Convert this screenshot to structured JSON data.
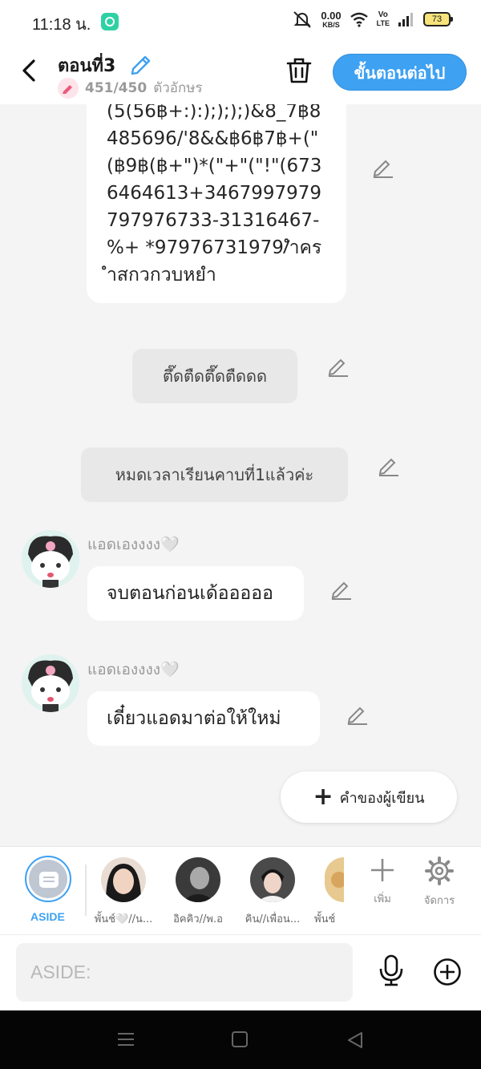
{
  "status": {
    "time": "11:18 น.",
    "net_speed": "0.00",
    "net_unit": "KB/S",
    "volte_top": "Vo",
    "volte_bottom": "LTE",
    "battery": "73"
  },
  "header": {
    "title": "ตอนที่3",
    "char_count": "451/450",
    "char_unit": "ตัวอักษร",
    "next_label": "ขั้นตอนต่อไป"
  },
  "messages": {
    "long_text": "(5(56฿+:):);););)&8_7฿8485696/'8&&฿6฿7฿+(\"(฿9฿(฿+\")*(\"+\"(\"!\"(6736464613+3467997979797976733-31316467-%+ *97976731979/ำครำสกวกวบหยำ",
    "narration1": "ตึ๊ดตืดตึ๊ดตืดดด",
    "narration2": "หมดเวลาเรียนคาบที่1แล้วค่ะ",
    "author_name1": "แอดเองงงง🤍",
    "bubble1": "จบตอนก่อนเด้อออออ",
    "author_name2": "แอดเองงงง🤍",
    "bubble2": "เดี๋ยวแอดมาต่อให้ใหม่",
    "fab_label": "คำของผู้เขียน"
  },
  "characters": {
    "aside_label": "ASIDE",
    "items": [
      {
        "label": "พั้นช์🤍//น..."
      },
      {
        "label": "อิคคิว//พ.อ"
      },
      {
        "label": "คิน//เพื่อน..."
      },
      {
        "label": "พั้นช์"
      }
    ],
    "add_label": "เพิ่ม",
    "manage_label": "จัดการ"
  },
  "input": {
    "placeholder": "ASIDE:"
  },
  "colors": {
    "accent": "#3ea1f2",
    "bubble_bg": "#ffffff",
    "narration_bg": "#e8e8e8",
    "chat_bg": "#f4f4f4"
  },
  "icons": [
    "back-icon",
    "pencil-icon",
    "trash-icon",
    "plus-icon",
    "gear-icon",
    "mic-icon",
    "add-circle-icon",
    "menu-icon",
    "home-icon",
    "back-triangle-icon"
  ]
}
